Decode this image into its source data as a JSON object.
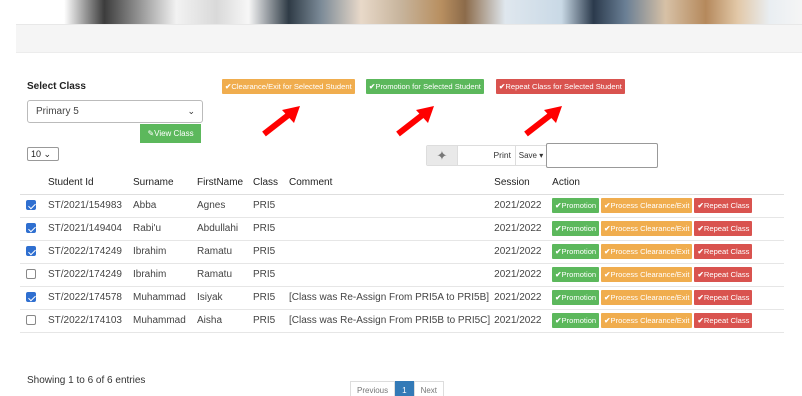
{
  "selection": {
    "label": "Select Class",
    "selected_class": "Primary 5",
    "view_button": "View Class"
  },
  "bulk_actions": {
    "clearance": "Clearance/Exit for Selected Student",
    "promotion": "Promotion for Selected Student",
    "repeat": "Repeat Class for Selected Student"
  },
  "table_controls": {
    "page_length": "10",
    "print": "Print",
    "save": "Save",
    "search_value": ""
  },
  "table": {
    "columns": [
      "Student Id",
      "Surname",
      "FirstName",
      "Class",
      "Comment",
      "Session",
      "Action"
    ],
    "rows": [
      {
        "checked": true,
        "id": "ST/2021/154983",
        "surname": "Abba",
        "firstname": "Agnes",
        "class": "PRI5",
        "comment": "",
        "session": "2021/2022"
      },
      {
        "checked": true,
        "id": "ST/2021/149404",
        "surname": "Rabi'u",
        "firstname": "Abdullahi",
        "class": "PRI5",
        "comment": "",
        "session": "2021/2022"
      },
      {
        "checked": true,
        "id": "ST/2022/174249",
        "surname": "Ibrahim",
        "firstname": "Ramatu",
        "class": "PRI5",
        "comment": "",
        "session": "2021/2022"
      },
      {
        "checked": false,
        "id": "ST/2022/174249",
        "surname": "Ibrahim",
        "firstname": "Ramatu",
        "class": "PRI5",
        "comment": "",
        "session": "2021/2022"
      },
      {
        "checked": true,
        "id": "ST/2022/174578",
        "surname": "Muhammad",
        "firstname": "Isiyak",
        "class": "PRI5",
        "comment": "[Class was Re-Assign From PRI5A to PRI5B]",
        "session": "2021/2022"
      },
      {
        "checked": false,
        "id": "ST/2022/174103",
        "surname": "Muhammad",
        "firstname": "Aisha",
        "class": "PRI5",
        "comment": "[Class was Re-Assign From PRI5B to PRI5C]",
        "session": "2021/2022"
      }
    ],
    "row_actions": {
      "promotion": "Promotion",
      "clearance": "Process Clearance/Exit",
      "repeat": "Repeat Class"
    }
  },
  "footer": {
    "showing": "Showing 1 to 6 of 6 entries",
    "previous": "Previous",
    "current_page": "1",
    "next": "Next"
  },
  "colors": {
    "orange": "#f0ad4e",
    "green": "#5cb85c",
    "red": "#d9534f",
    "annotation_arrow": "#ff0000",
    "page_active": "#337ab7"
  }
}
